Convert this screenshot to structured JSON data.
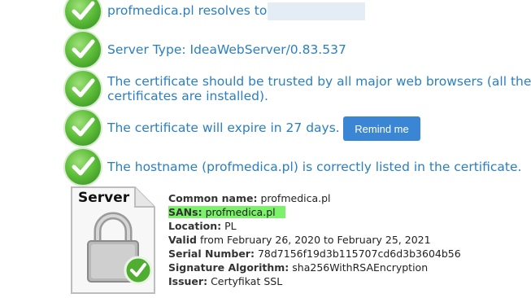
{
  "checks": [
    {
      "text": "profmedica.pl resolves to"
    },
    {
      "text": "Server Type: IdeaWebServer/0.83.537"
    },
    {
      "text1": "The certificate should be trusted by all major web browsers (all the c",
      "text2": "certificates are installed)."
    },
    {
      "text": "The certificate will expire in 27 days."
    },
    {
      "text": "The hostname (profmedica.pl) is correctly listed in the certificate."
    }
  ],
  "remind_label": "Remind me",
  "server_label": "Server",
  "cert": {
    "common_name_label": "Common name:",
    "common_name": "profmedica.pl",
    "sans_label": "SANs:",
    "sans": "profmedica.pl",
    "location_label": "Location:",
    "location": "PL",
    "valid_label": "Valid",
    "valid": "from February 26, 2020 to February 25, 2021",
    "serial_label": "Serial Number:",
    "serial": "78d7156f19d3b115707cd6d3b3604b56",
    "sig_label": "Signature Algorithm:",
    "sig": "sha256WithRSAEncryption",
    "issuer_label": "Issuer:",
    "issuer": "Certyfikat SSL"
  },
  "colors": {
    "link_blue": "#2a7fc1",
    "button_blue": "#3b86d4",
    "check_green": "#5fbf3b",
    "highlight": "#7cf26a"
  }
}
